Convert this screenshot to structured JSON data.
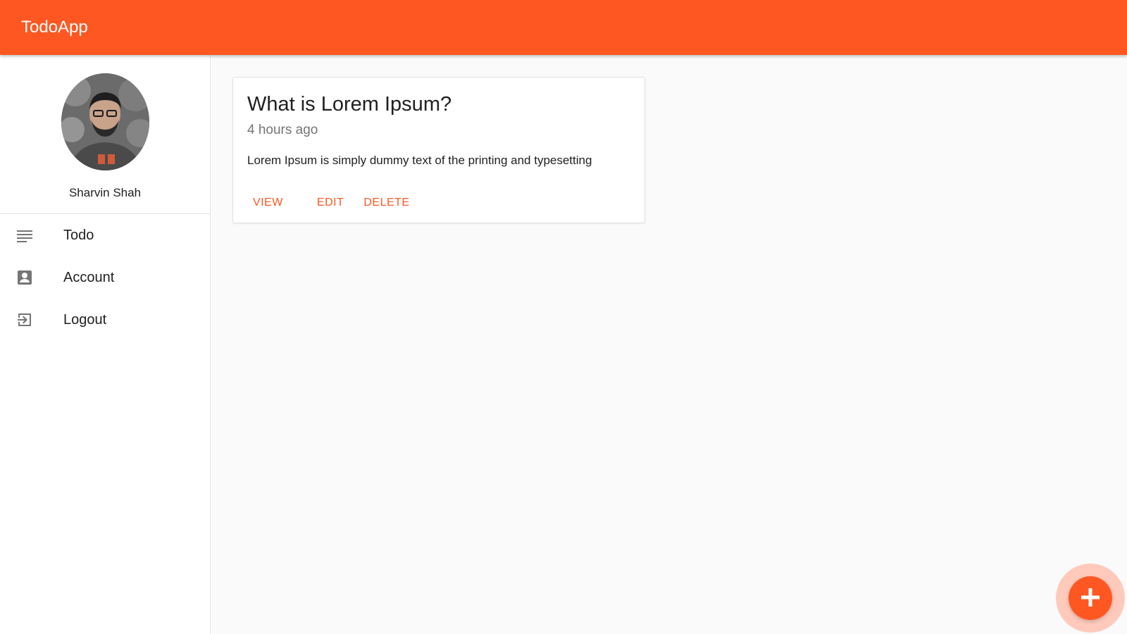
{
  "app": {
    "title": "TodoApp",
    "accent_color": "#ff5722"
  },
  "sidebar": {
    "profile": {
      "name": "Sharvin Shah",
      "avatar_icon": "user-photo"
    },
    "items": [
      {
        "label": "Todo",
        "icon": "notes-icon"
      },
      {
        "label": "Account",
        "icon": "account-box-icon"
      },
      {
        "label": "Logout",
        "icon": "logout-icon"
      }
    ]
  },
  "todos": [
    {
      "title": "What is Lorem Ipsum?",
      "time": "4 hours ago",
      "body": "Lorem Ipsum is simply dummy text of the printing and typesetting",
      "actions": {
        "view": "VIEW",
        "edit": "EDIT",
        "delete": "DELETE"
      }
    }
  ],
  "fab": {
    "icon": "add-icon"
  }
}
